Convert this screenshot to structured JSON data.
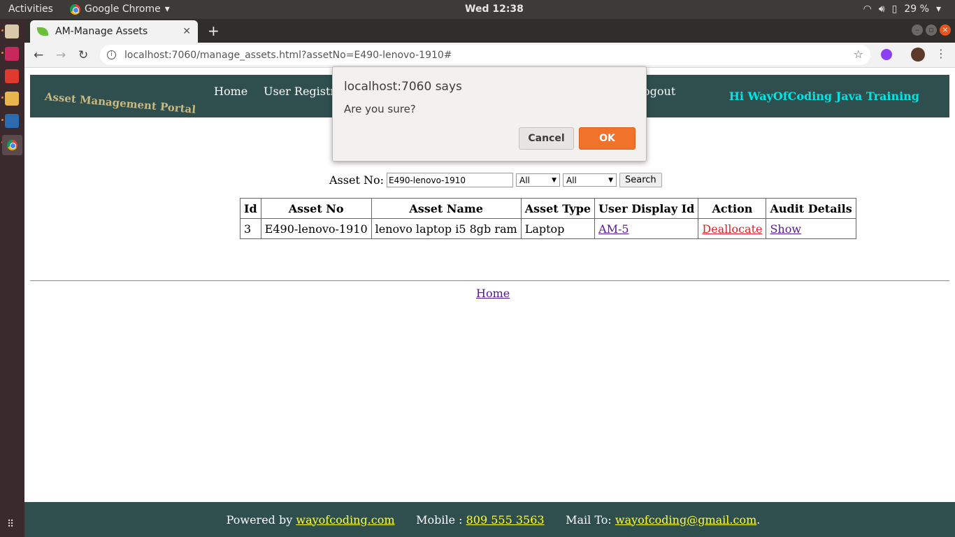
{
  "system": {
    "activities": "Activities",
    "app_name": "Google Chrome",
    "clock": "Wed 12:38",
    "battery": "29 %"
  },
  "browser": {
    "tab_title": "AM-Manage Assets",
    "url": "localhost:7060/manage_assets.html?assetNo=E490-lenovo-1910#"
  },
  "site": {
    "brand": "Asset Management Portal",
    "nav": [
      "Home",
      "User Registratio",
      "ogout"
    ],
    "greeting": "Hi WayOfCoding Java Training"
  },
  "search": {
    "label": "Asset No:",
    "value": "E490-lenovo-1910",
    "select1": "All",
    "select2": "All",
    "button": "Search"
  },
  "table": {
    "headers": [
      "Id",
      "Asset No",
      "Asset Name",
      "Asset Type",
      "User Display Id",
      "Action",
      "Audit Details"
    ],
    "rows": [
      {
        "id": "3",
        "asset_no": "E490-lenovo-1910",
        "asset_name": "lenovo laptop i5 8gb ram",
        "asset_type": "Laptop",
        "user_display_id": "AM-5",
        "action": "Deallocate",
        "audit": "Show"
      }
    ]
  },
  "home_link": "Home",
  "footer": {
    "powered_prefix": "Powered by ",
    "powered_link": "wayofcoding.com",
    "mobile_prefix": "      Mobile : ",
    "mobile_link": "809 555 3563",
    "mail_prefix": "      Mail To: ",
    "mail_link": "wayofcoding@gmail.com",
    "mail_suffix": "."
  },
  "dialog": {
    "title": "localhost:7060 says",
    "message": "Are you sure?",
    "cancel": "Cancel",
    "ok": "OK"
  },
  "colors": {
    "header_bg": "#2f4f4f",
    "greeting": "#00e5e5",
    "ok_button": "#f0722b",
    "footer_link": "#ffff33",
    "action_link": "#dd2222"
  }
}
